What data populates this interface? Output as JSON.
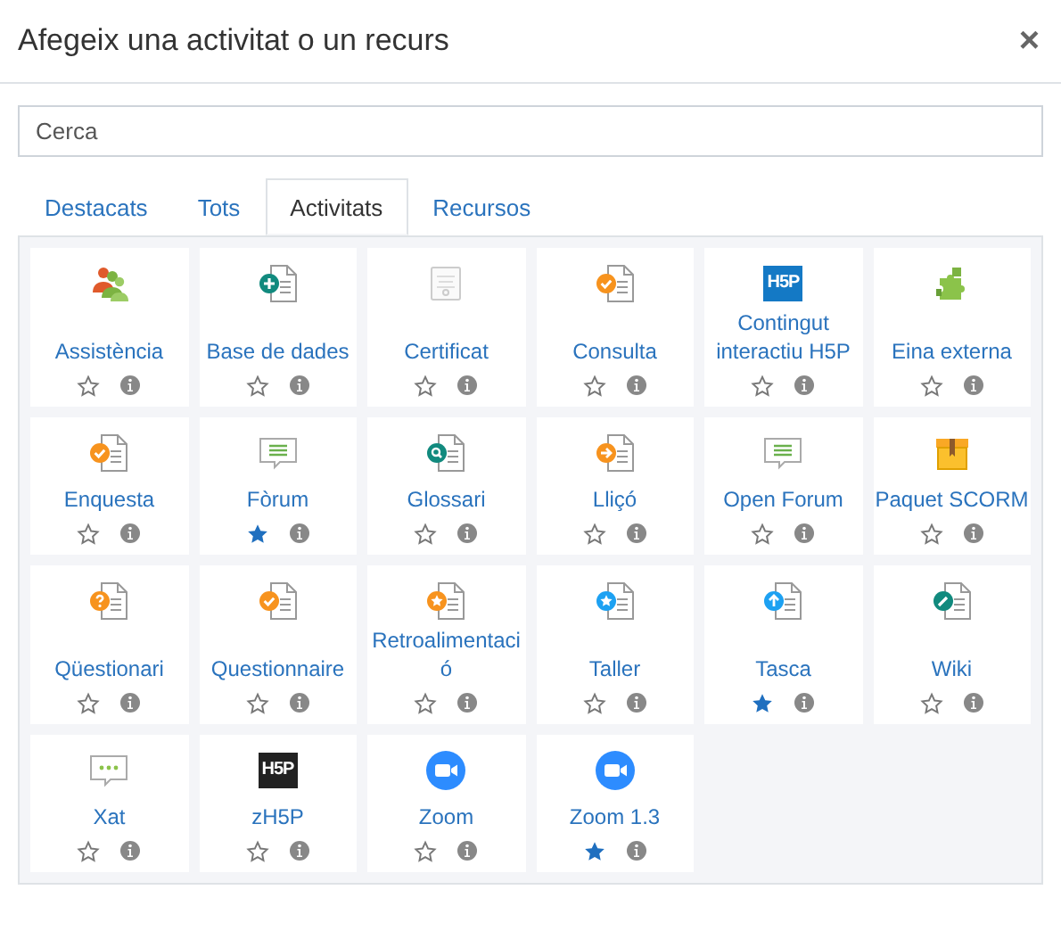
{
  "dialog": {
    "title": "Afegeix una activitat o un recurs",
    "close": "×"
  },
  "search": {
    "placeholder": "Cerca"
  },
  "tabs": [
    {
      "label": "Destacats",
      "selected": false
    },
    {
      "label": "Tots",
      "selected": false
    },
    {
      "label": "Activitats",
      "selected": true
    },
    {
      "label": "Recursos",
      "selected": false
    }
  ],
  "items": [
    {
      "name": "Assistència",
      "starred": false
    },
    {
      "name": "Base de dades",
      "starred": false
    },
    {
      "name": "Certificat",
      "starred": false
    },
    {
      "name": "Consulta",
      "starred": false
    },
    {
      "name": "Contingut interactiu H5P",
      "starred": false,
      "logo_text": "H5P"
    },
    {
      "name": "Eina externa",
      "starred": false
    },
    {
      "name": "Enquesta",
      "starred": false
    },
    {
      "name": "Fòrum",
      "starred": true
    },
    {
      "name": "Glossari",
      "starred": false
    },
    {
      "name": "Lliçó",
      "starred": false
    },
    {
      "name": "Open Forum",
      "starred": false
    },
    {
      "name": "Paquet SCORM",
      "starred": false
    },
    {
      "name": "Qüestionari",
      "starred": false
    },
    {
      "name": "Questionnaire",
      "starred": false
    },
    {
      "name": "Retroalimentació",
      "starred": false
    },
    {
      "name": "Taller",
      "starred": false
    },
    {
      "name": "Tasca",
      "starred": true
    },
    {
      "name": "Wiki",
      "starred": false
    },
    {
      "name": "Xat",
      "starred": false
    },
    {
      "name": "zH5P",
      "starred": false,
      "logo_text": "H5P"
    },
    {
      "name": "Zoom",
      "starred": false
    },
    {
      "name": "Zoom 1.3",
      "starred": true
    }
  ]
}
